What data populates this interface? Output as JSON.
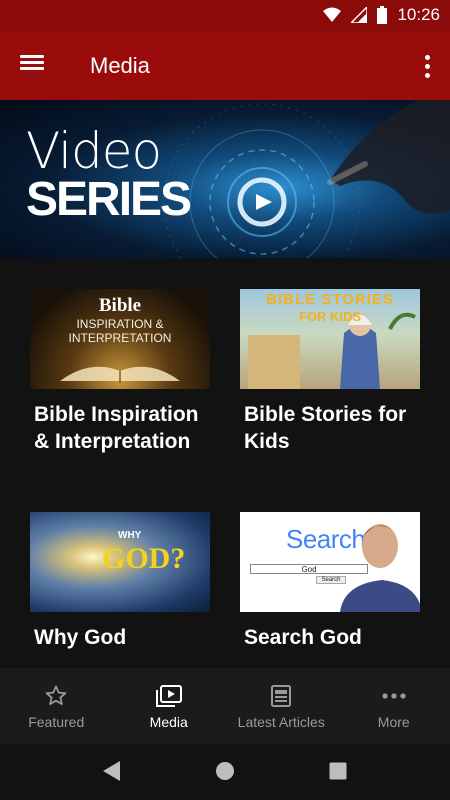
{
  "status_bar": {
    "time": "10:26"
  },
  "app_bar": {
    "title": "Media"
  },
  "banner": {
    "line1": "Video",
    "line2": "SERIES"
  },
  "cards": [
    {
      "label": "Bible Inspiration & Interpretation",
      "thumb_line1": "Bible",
      "thumb_line2": "INSPIRATION &",
      "thumb_line3": "INTERPRETATION"
    },
    {
      "label": "Bible Stories for Kids",
      "thumb_line1": "BIBLE STORIES",
      "thumb_line2": "FOR KIDS"
    },
    {
      "label": "Why God",
      "thumb_line1": "WHY",
      "thumb_line2": "GOD?"
    },
    {
      "label": "Search God",
      "thumb_line1": "Search",
      "thumb_query": "God",
      "thumb_button": "Search"
    }
  ],
  "bottom_nav": [
    {
      "label": "Featured",
      "icon": "star-icon",
      "active": false
    },
    {
      "label": "Media",
      "icon": "video-library-icon",
      "active": true
    },
    {
      "label": "Latest Articles",
      "icon": "article-icon",
      "active": false
    },
    {
      "label": "More",
      "icon": "more-horizontal-icon",
      "active": false
    }
  ],
  "colors": {
    "primary": "#9a0b0b",
    "status_bar": "#8b0a0a",
    "background": "#121212",
    "nav_background": "#1b1b1b",
    "nav_inactive": "#9a9a9a"
  }
}
